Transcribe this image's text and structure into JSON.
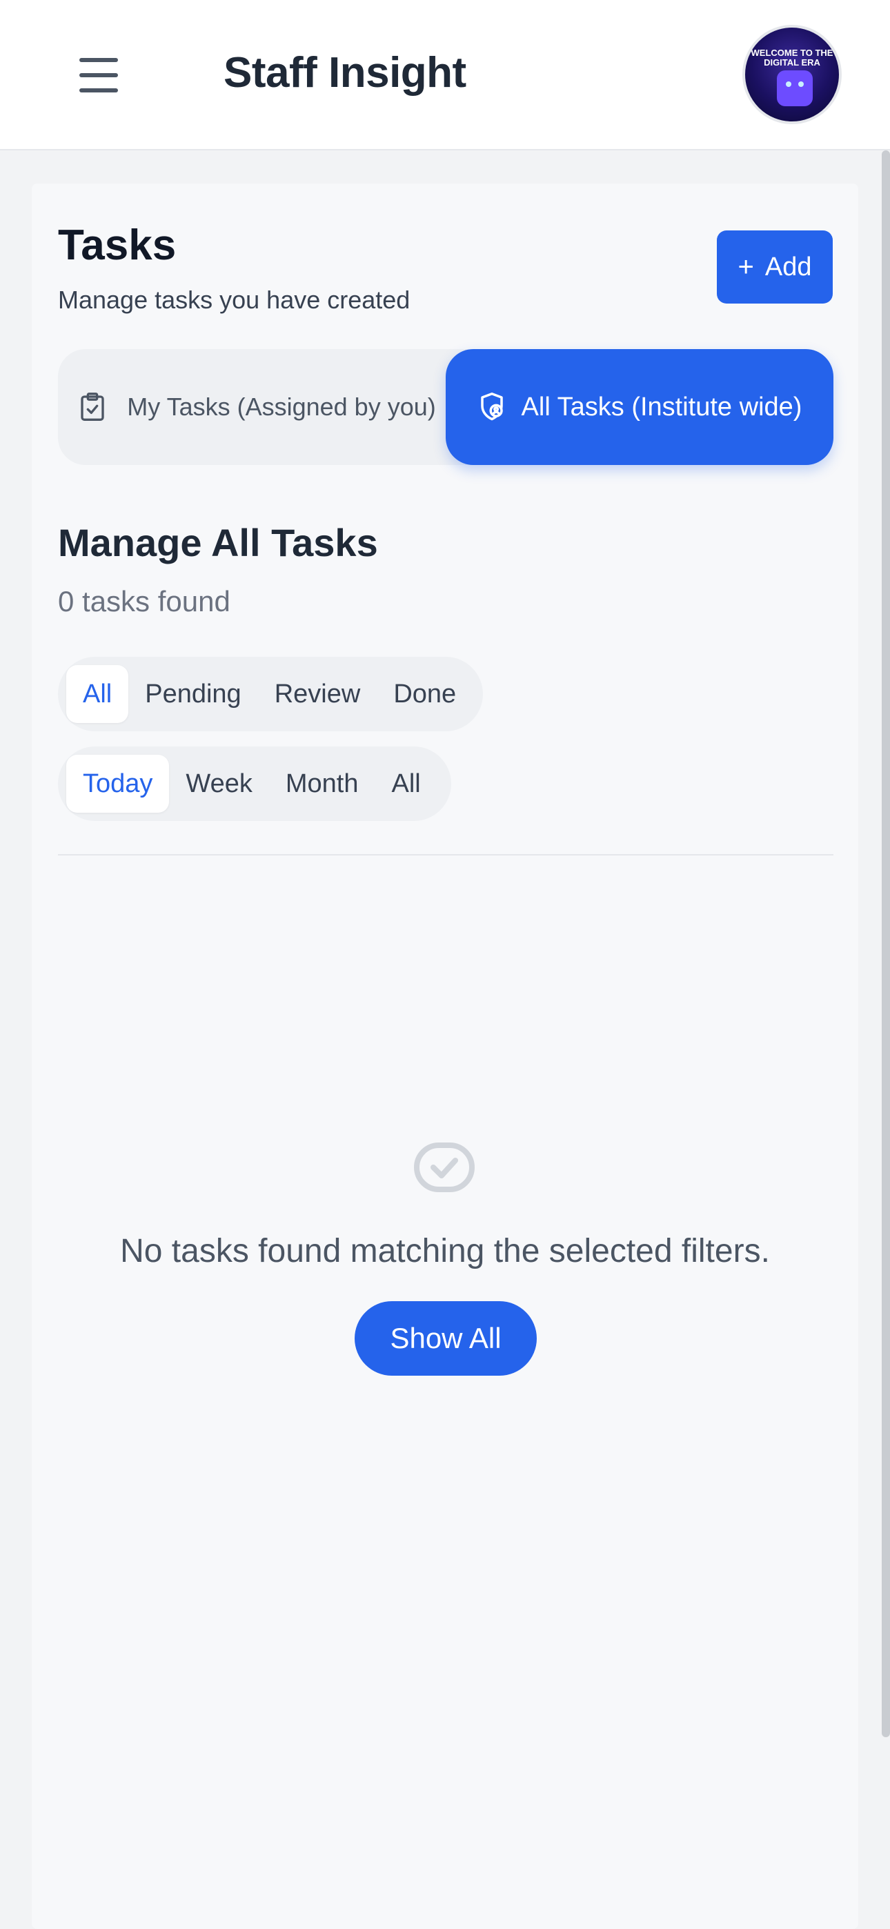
{
  "header": {
    "title": "Staff Insight",
    "menu_icon": "hamburger-menu-icon",
    "avatar_text": "WELCOME TO THE DIGITAL ERA"
  },
  "page": {
    "title": "Tasks",
    "subtitle": "Manage tasks you have created",
    "add_button": {
      "icon": "+",
      "label": "Add"
    }
  },
  "scope_tabs": {
    "my": {
      "icon": "clipboard-check-icon",
      "label": "My Tasks (Assigned by you)"
    },
    "all": {
      "icon": "shield-user-icon",
      "label": "All Tasks (Institute wide)",
      "active": true
    }
  },
  "section": {
    "title": "Manage All Tasks",
    "count_text": "0 tasks found"
  },
  "filters": {
    "status": [
      "All",
      "Pending",
      "Review",
      "Done"
    ],
    "status_active": "All",
    "period": [
      "Today",
      "Week",
      "Month",
      "All"
    ],
    "period_active": "Today"
  },
  "empty_state": {
    "icon": "check-circle-icon",
    "message": "No tasks found matching the selected filters.",
    "button_label": "Show All"
  },
  "colors": {
    "primary": "#2563eb",
    "background": "#f2f3f5",
    "card": "#f7f8fa"
  }
}
